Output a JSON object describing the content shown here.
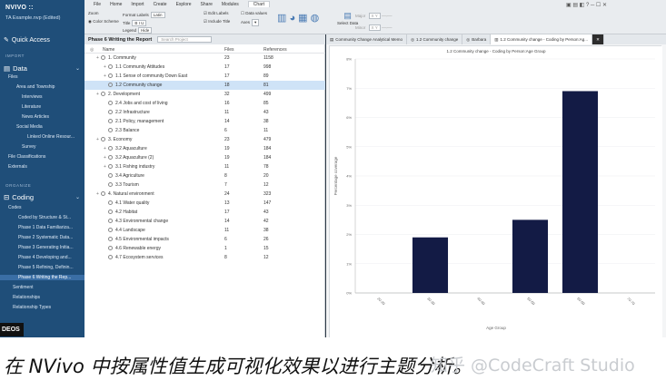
{
  "app": {
    "brand": "NVIVO ::",
    "project": "TA Example.nvp (Edited)"
  },
  "sidebar": {
    "quick_access": "Quick Access",
    "import_label": "IMPORT",
    "data_label": "Data",
    "data_items": [
      "Files",
      "Area and Township",
      "Interviews",
      "Literature",
      "News Articles",
      "Social Media",
      "Linked Online Resour...",
      "Survey",
      "File Classifications",
      "Externals"
    ],
    "organize_label": "ORGANIZE",
    "coding_label": "Coding",
    "coding_items": [
      "Codes",
      "Coded by Structure & St...",
      "Phase 1 Data Familiariza...",
      "Phase 2 Systematic Data...",
      "Phase 3 Generating Initia...",
      "Phase 4 Developing and...",
      "Phase 5 Refining, Definin...",
      "Phase 6 Writing the Rep...",
      "Sentiment",
      "Relationships",
      "Relationship Types"
    ]
  },
  "ribbon": {
    "menus": [
      "File",
      "Home",
      "Import",
      "Create",
      "Explore",
      "Share",
      "Modules",
      "Chart"
    ],
    "zoom_label": "Zoom",
    "color_scheme": "Color Scheme",
    "format_labels": "Format Labels",
    "format_value": "Latin",
    "title_label": "Title",
    "legend_label": "Legend",
    "legend_value": "Hide",
    "edit_labels": "Edit Labels",
    "include_title": "Include Title",
    "data_values": "Data values",
    "axis_label": "Axes",
    "select_data": "Select Data",
    "major_label": "Major",
    "minor_label": "Minor",
    "xy_label": "X Y"
  },
  "left_pane": {
    "title": "Phase 6 Writing the Report",
    "search_placeholder": "Search Project",
    "columns": [
      "Name",
      "Files",
      "References"
    ],
    "rows": [
      {
        "name": "1. Community",
        "files": "23",
        "refs": "1158",
        "depth": 0,
        "expand": true,
        "sel": false
      },
      {
        "name": "1.1 Community Attitudes",
        "files": "17",
        "refs": "998",
        "depth": 1,
        "expand": true,
        "sel": false
      },
      {
        "name": "1.1 Sense of community Down East",
        "files": "17",
        "refs": "89",
        "depth": 1,
        "expand": true,
        "sel": false
      },
      {
        "name": "1.2 Community change",
        "files": "18",
        "refs": "81",
        "depth": 1,
        "expand": false,
        "sel": true
      },
      {
        "name": "2. Development",
        "files": "32",
        "refs": "499",
        "depth": 0,
        "expand": true,
        "sel": false
      },
      {
        "name": "2.4 Jobs and cost of living",
        "files": "16",
        "refs": "85",
        "depth": 1,
        "expand": false,
        "sel": false
      },
      {
        "name": "2.2 Infrastructure",
        "files": "11",
        "refs": "43",
        "depth": 1,
        "expand": false,
        "sel": false
      },
      {
        "name": "2.1 Policy, management",
        "files": "14",
        "refs": "38",
        "depth": 1,
        "expand": false,
        "sel": false
      },
      {
        "name": "2.3 Balance",
        "files": "6",
        "refs": "11",
        "depth": 1,
        "expand": false,
        "sel": false
      },
      {
        "name": "3. Economy",
        "files": "23",
        "refs": "479",
        "depth": 0,
        "expand": true,
        "sel": false
      },
      {
        "name": "3.2 Aquaculture",
        "files": "19",
        "refs": "184",
        "depth": 1,
        "expand": true,
        "sel": false
      },
      {
        "name": "3.2 Aquaculture (2)",
        "files": "19",
        "refs": "184",
        "depth": 1,
        "expand": true,
        "sel": false
      },
      {
        "name": "3.1 Fishing industry",
        "files": "11",
        "refs": "78",
        "depth": 1,
        "expand": true,
        "sel": false
      },
      {
        "name": "3.4 Agriculture",
        "files": "8",
        "refs": "20",
        "depth": 1,
        "expand": false,
        "sel": false
      },
      {
        "name": "3.3 Tourism",
        "files": "7",
        "refs": "12",
        "depth": 1,
        "expand": false,
        "sel": false
      },
      {
        "name": "4. Natural environment",
        "files": "24",
        "refs": "323",
        "depth": 0,
        "expand": true,
        "sel": false
      },
      {
        "name": "4.1 Water quality",
        "files": "13",
        "refs": "147",
        "depth": 1,
        "expand": false,
        "sel": false
      },
      {
        "name": "4.2 Habitat",
        "files": "17",
        "refs": "43",
        "depth": 1,
        "expand": false,
        "sel": false
      },
      {
        "name": "4.3 Environmental change",
        "files": "14",
        "refs": "42",
        "depth": 1,
        "expand": false,
        "sel": false
      },
      {
        "name": "4.4 Landscape",
        "files": "11",
        "refs": "38",
        "depth": 1,
        "expand": false,
        "sel": false
      },
      {
        "name": "4.5 Environmental impacts",
        "files": "6",
        "refs": "26",
        "depth": 1,
        "expand": false,
        "sel": false
      },
      {
        "name": "4.6 Renewable energy",
        "files": "1",
        "refs": "15",
        "depth": 1,
        "expand": false,
        "sel": false
      },
      {
        "name": "4.7 Ecosystem services",
        "files": "8",
        "refs": "12",
        "depth": 1,
        "expand": false,
        "sel": false
      }
    ]
  },
  "right_pane": {
    "tabs": [
      "Community Change Analytical Memo",
      "1.2 Community change",
      "Barbara",
      "1.2 Community change - Coding by Person:Ag..."
    ]
  },
  "chart_data": {
    "type": "bar",
    "title": "1.2 Community change - Coding by Person:Age Group",
    "xlabel": "Age Group",
    "ylabel": "Percentage coverage",
    "categories": [
      "20-29",
      "30-39",
      "40-49",
      "50-59",
      "60-69",
      "70-79"
    ],
    "values": [
      0,
      1.9,
      0,
      2.5,
      6.9,
      0
    ],
    "ylim": [
      0,
      8
    ],
    "yticks": [
      "0%",
      "1%",
      "2%",
      "3%",
      "4%",
      "5%",
      "6%",
      "7%",
      "8%"
    ],
    "bar_color": "#131b45"
  },
  "overlay": {
    "badge": "DEOS",
    "caption": "在 NVivo 中按属性值生成可视化效果以进行主题分析。",
    "watermark": "知乎 @CodeCraft Studio"
  }
}
